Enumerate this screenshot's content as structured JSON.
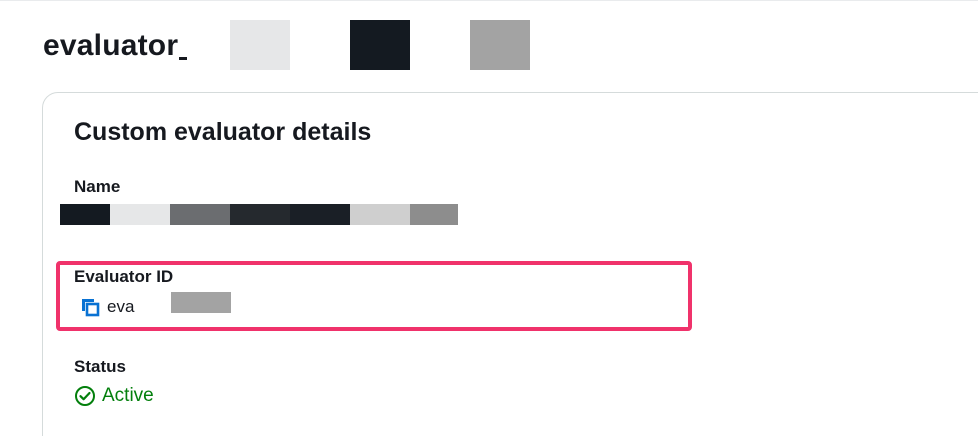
{
  "header": {
    "title": "evaluator"
  },
  "card": {
    "title": "Custom evaluator details",
    "name": {
      "label": "Name"
    },
    "evaluator_id": {
      "label": "Evaluator ID",
      "value": "eva",
      "copy_icon": "copy-icon"
    },
    "status": {
      "label": "Status",
      "value": "Active",
      "icon": "check-circle-icon",
      "color": "#037f0c"
    }
  },
  "colors": {
    "highlight_border": "#f0326b",
    "copy_icon": "#0972d3"
  }
}
